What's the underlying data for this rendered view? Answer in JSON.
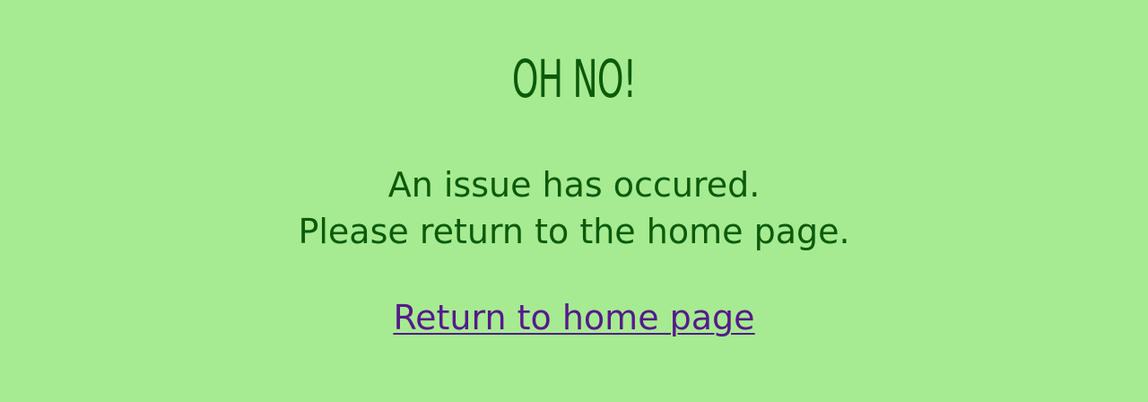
{
  "error_page": {
    "headline": "OH NO!",
    "message_line1": "An issue has occured.",
    "message_line2": "Please return to the home page.",
    "home_link_label": "Return to home page"
  },
  "colors": {
    "background": "#a6eb91",
    "text": "#0c5a0a",
    "link": "#551a8b"
  }
}
